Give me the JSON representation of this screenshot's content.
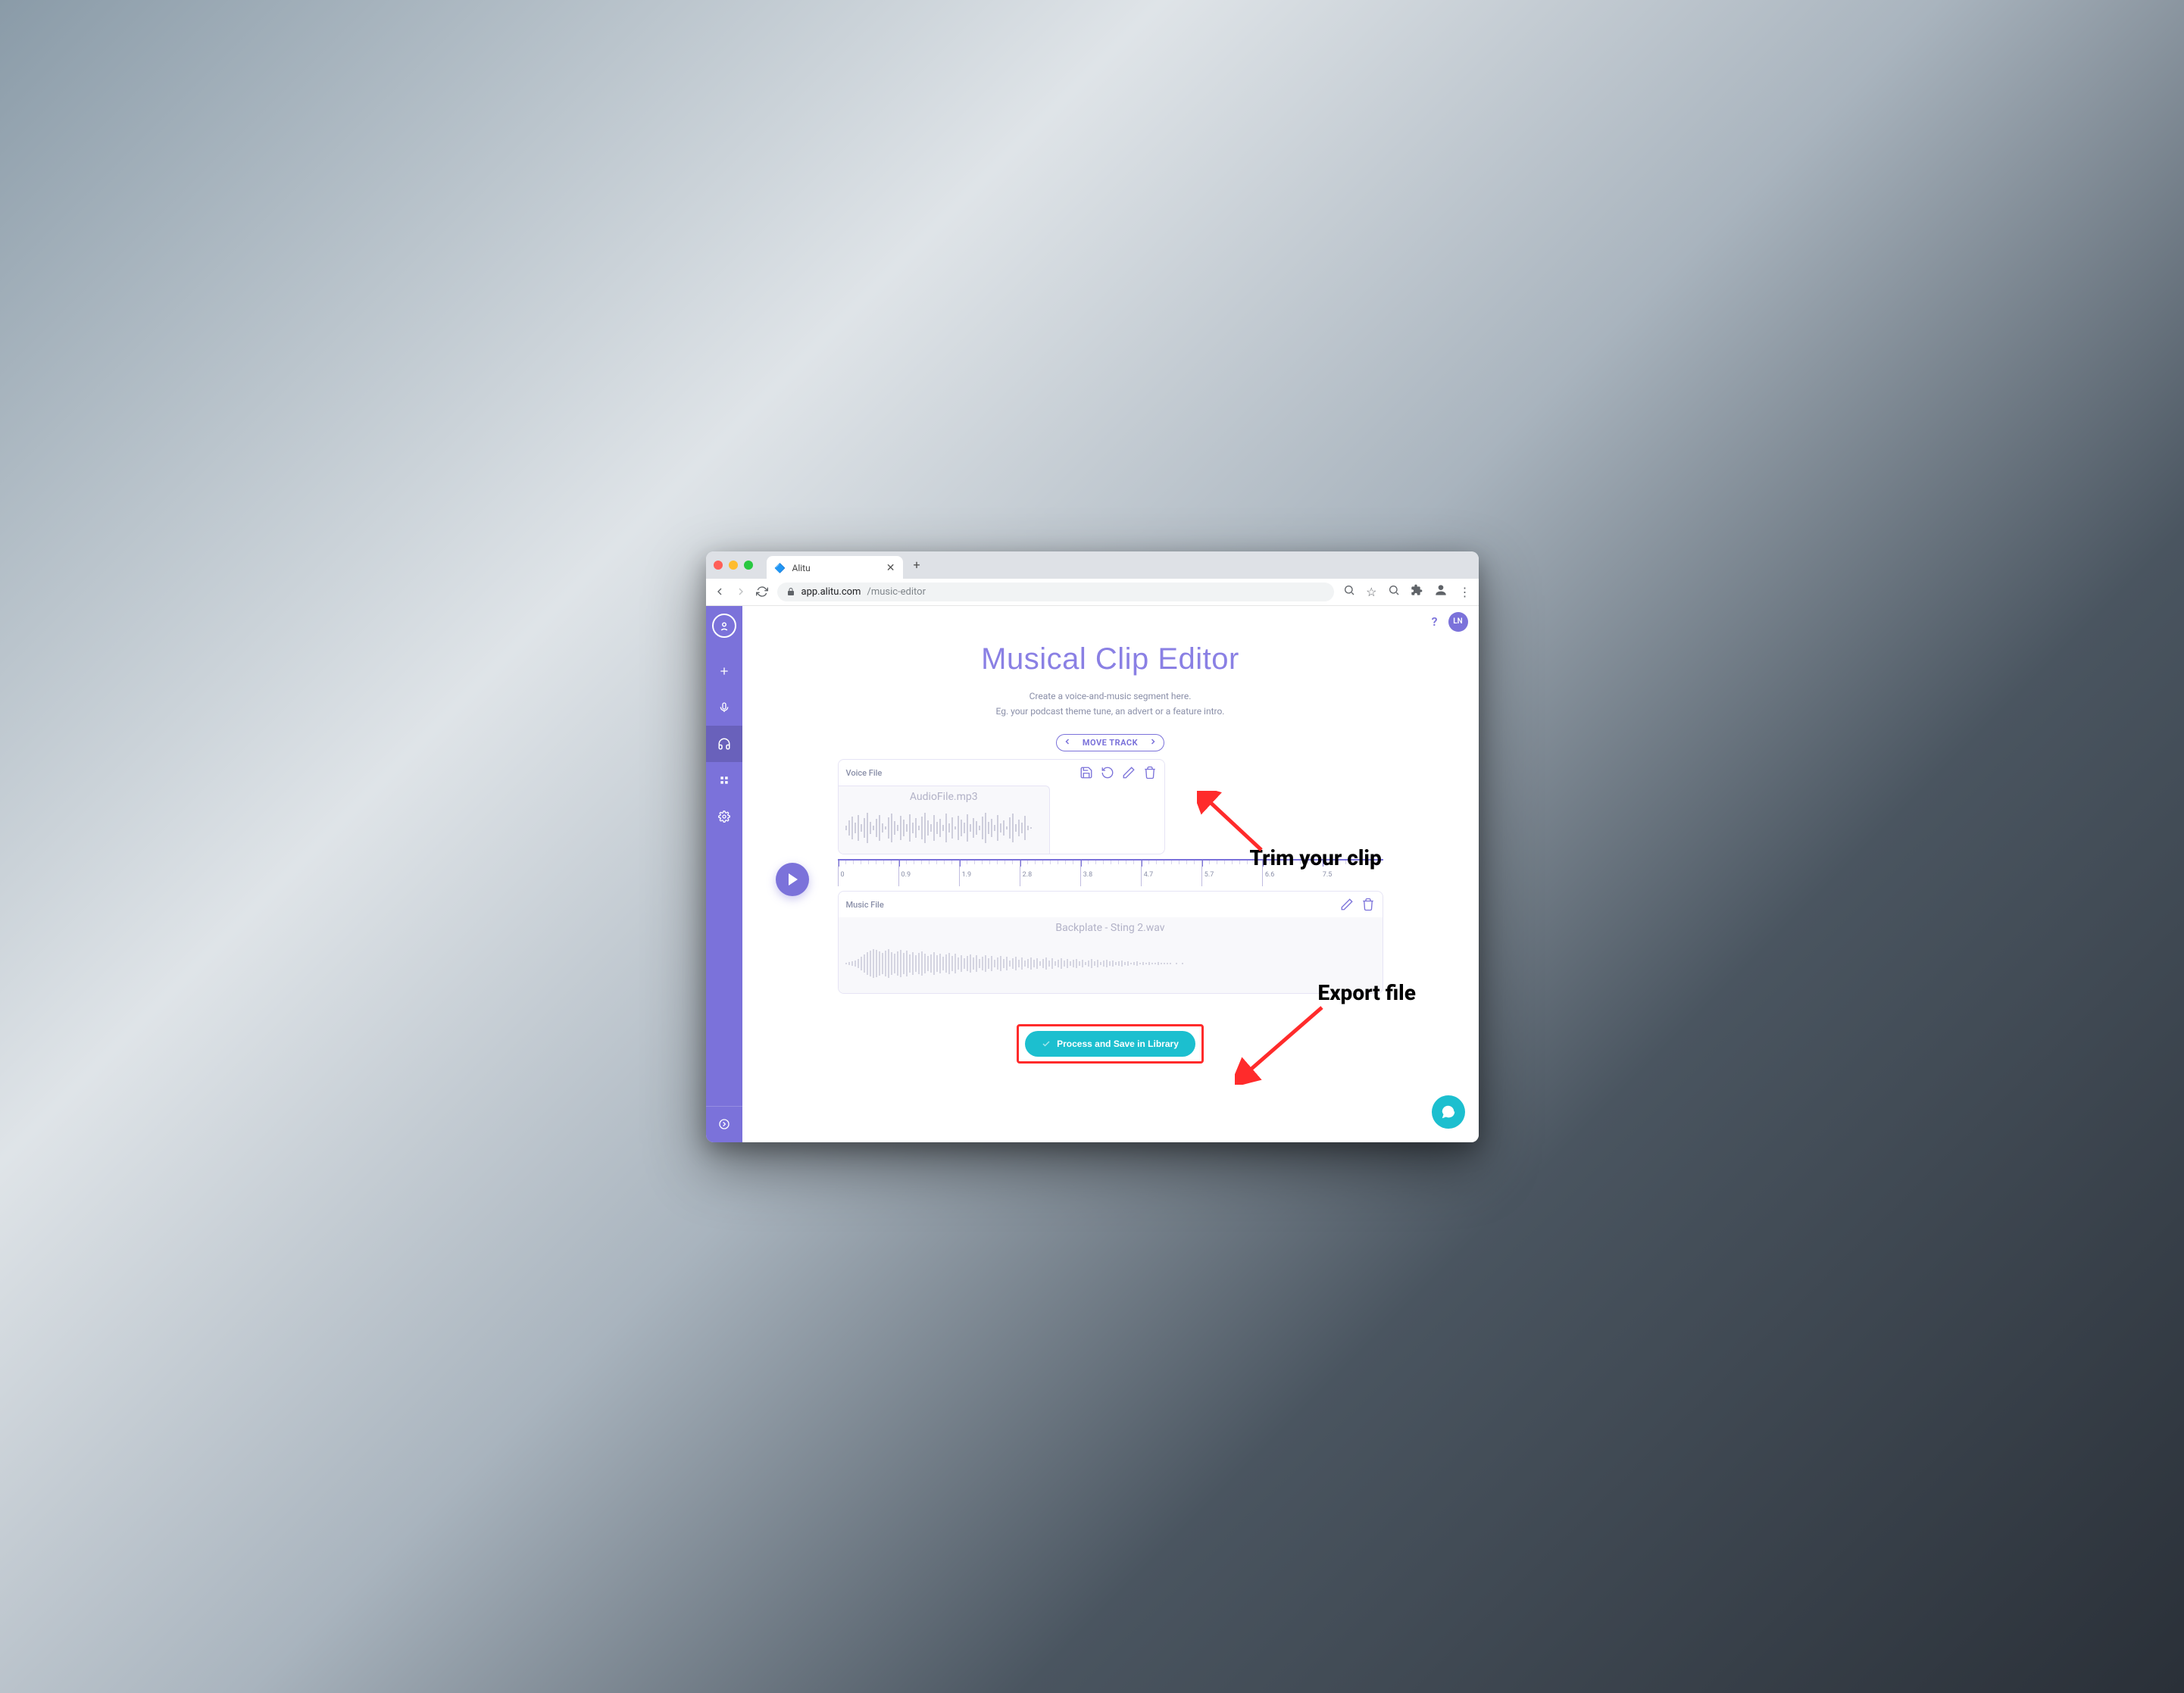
{
  "browser": {
    "tab_title": "Alitu",
    "url_host": "app.alitu.com",
    "url_path": "/music-editor"
  },
  "sidebar": {
    "items": [
      "add",
      "mic",
      "headphones",
      "grid",
      "settings"
    ],
    "active_index": 2
  },
  "user": {
    "help_label": "?",
    "avatar_initials": "LN"
  },
  "page": {
    "title": "Musical Clip Editor",
    "subtitle_line1": "Create a voice-and-music segment here.",
    "subtitle_line2": "Eg. your podcast theme tune, an advert or a feature intro."
  },
  "editor": {
    "move_track_label": "MOVE TRACK",
    "voice": {
      "label": "Voice File",
      "filename": "AudioFile.mp3"
    },
    "music": {
      "label": "Music File",
      "filename": "Backplate - Sting 2.wav"
    },
    "timeline_ticks": [
      "0",
      "0.9",
      "1.9",
      "2.8",
      "3.8",
      "4.7",
      "5.7",
      "6.6",
      "7.5"
    ]
  },
  "actions": {
    "process_label": "Process and Save in Library"
  },
  "annotations": {
    "trim": "Trim your clip",
    "export": "Export file"
  }
}
